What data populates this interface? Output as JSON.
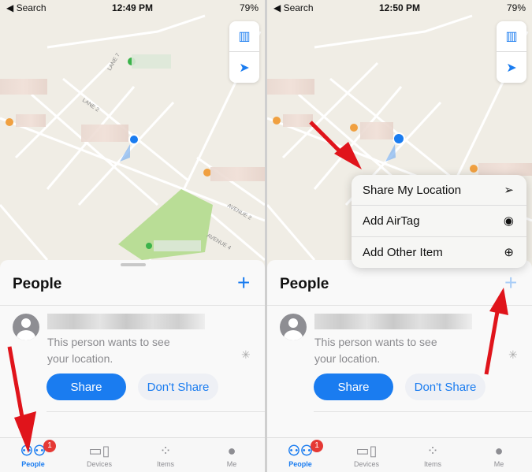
{
  "panels": [
    {
      "status": {
        "back": "◀ Search",
        "time": "12:49 PM",
        "battery": "79%"
      },
      "map": {
        "labels": [
          "LANE 7",
          "LANE 2",
          "AVENUE 2",
          "AVENUE 4",
          "De"
        ]
      },
      "sheet": {
        "title": "People",
        "request": {
          "line1": "This person wants to see",
          "line2": "your location.",
          "share": "Share",
          "dont_share": "Don't Share"
        }
      },
      "tabs": [
        {
          "label": "People",
          "badge": "1",
          "active": true
        },
        {
          "label": "Devices"
        },
        {
          "label": "Items"
        },
        {
          "label": "Me"
        }
      ]
    },
    {
      "status": {
        "back": "◀ Search",
        "time": "12:50 PM",
        "battery": "79%"
      },
      "map": {
        "labels": [
          "De"
        ]
      },
      "menu": [
        {
          "label": "Share My Location",
          "icon": "location-arrow-icon"
        },
        {
          "label": "Add AirTag",
          "icon": "airtag-icon"
        },
        {
          "label": "Add Other Item",
          "icon": "plus-circle-icon"
        }
      ],
      "sheet": {
        "title": "People",
        "request": {
          "line1": "This person wants to see",
          "line2": "your location.",
          "share": "Share",
          "dont_share": "Don't Share"
        }
      },
      "tabs": [
        {
          "label": "People",
          "badge": "1",
          "active": true
        },
        {
          "label": "Devices"
        },
        {
          "label": "Items"
        },
        {
          "label": "Me"
        }
      ]
    }
  ],
  "colors": {
    "accent": "#1a7cf0",
    "annotation": "#e0141b",
    "badge": "#e53935"
  }
}
